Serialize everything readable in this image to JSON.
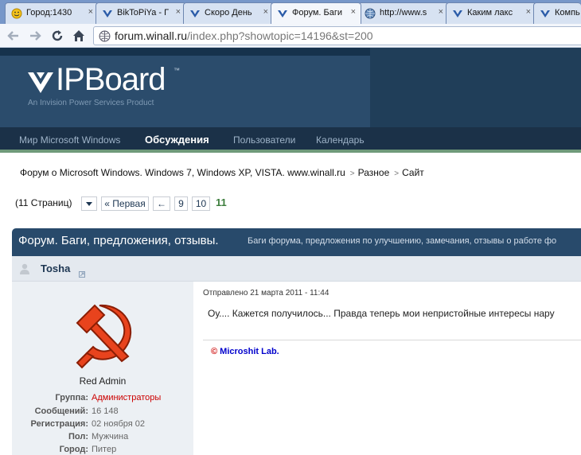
{
  "browser": {
    "tabs": [
      {
        "title": "Город:1430",
        "icon": "smiley-icon"
      },
      {
        "title": "BikToPiYa - Г",
        "icon": "ipb-logo-icon"
      },
      {
        "title": "Скоро День",
        "icon": "ipb-logo-icon"
      },
      {
        "title": "Форум. Баги",
        "icon": "ipb-logo-icon",
        "active": true
      },
      {
        "title": "http://www.s",
        "icon": "globe-icon"
      },
      {
        "title": "Каким лакс",
        "icon": "ipb-logo-icon"
      },
      {
        "title": "Компь",
        "icon": "ipb-logo-icon"
      }
    ],
    "close_glyph": "×",
    "url_host": "forum.winall.ru",
    "url_path": "/index.php?showtopic=14196&st=200"
  },
  "site": {
    "logo_text": "IPBoard",
    "logo_tm": "™",
    "logo_subtitle": "An Invision Power Services Product"
  },
  "nav": {
    "items": [
      "Мир Microsoft Windows",
      "Обсуждения",
      "Пользователи",
      "Календарь"
    ],
    "active_index": 1
  },
  "breadcrumb": {
    "items": [
      "Форум о Microsoft Windows. Windows 7, Windows XP, VISTA. www.winall.ru",
      "Разное",
      "Сайт"
    ],
    "separator": ">"
  },
  "pagination": {
    "label": "(11 Страниц)",
    "first": "« Первая",
    "prev": "←",
    "pages": [
      "9",
      "10"
    ],
    "current": "11"
  },
  "topic": {
    "title": "Форум. Баги, предложения, отзывы.",
    "description": "Баги форума, предложения по улучшению, замечания, отзывы о работе фо"
  },
  "post": {
    "author": "Tosha",
    "rank": "Red Admin",
    "date": "Отправлено 21 марта 2011 - 11:44",
    "text": "Оу.... Кажется получилось... Правда теперь мои непристойные интересы нару",
    "signature_copy": "©",
    "signature_text": "Microshit Lab.",
    "info": [
      {
        "label": "Группа:",
        "value": "Администраторы"
      },
      {
        "label": "Сообщений:",
        "value": "16 148"
      },
      {
        "label": "Регистрация:",
        "value": "02 ноября 02"
      },
      {
        "label": "Пол:",
        "value": "Мужчина"
      },
      {
        "label": "Город:",
        "value": "Питер"
      }
    ]
  },
  "colors": {
    "header_bg": "#203e59",
    "nav_bg": "#1b3148",
    "topic_bar": "#284a6b",
    "group_color": "#cc0000",
    "current_page": "#3c7d3c",
    "hammer_sickle": "#e8431d"
  }
}
